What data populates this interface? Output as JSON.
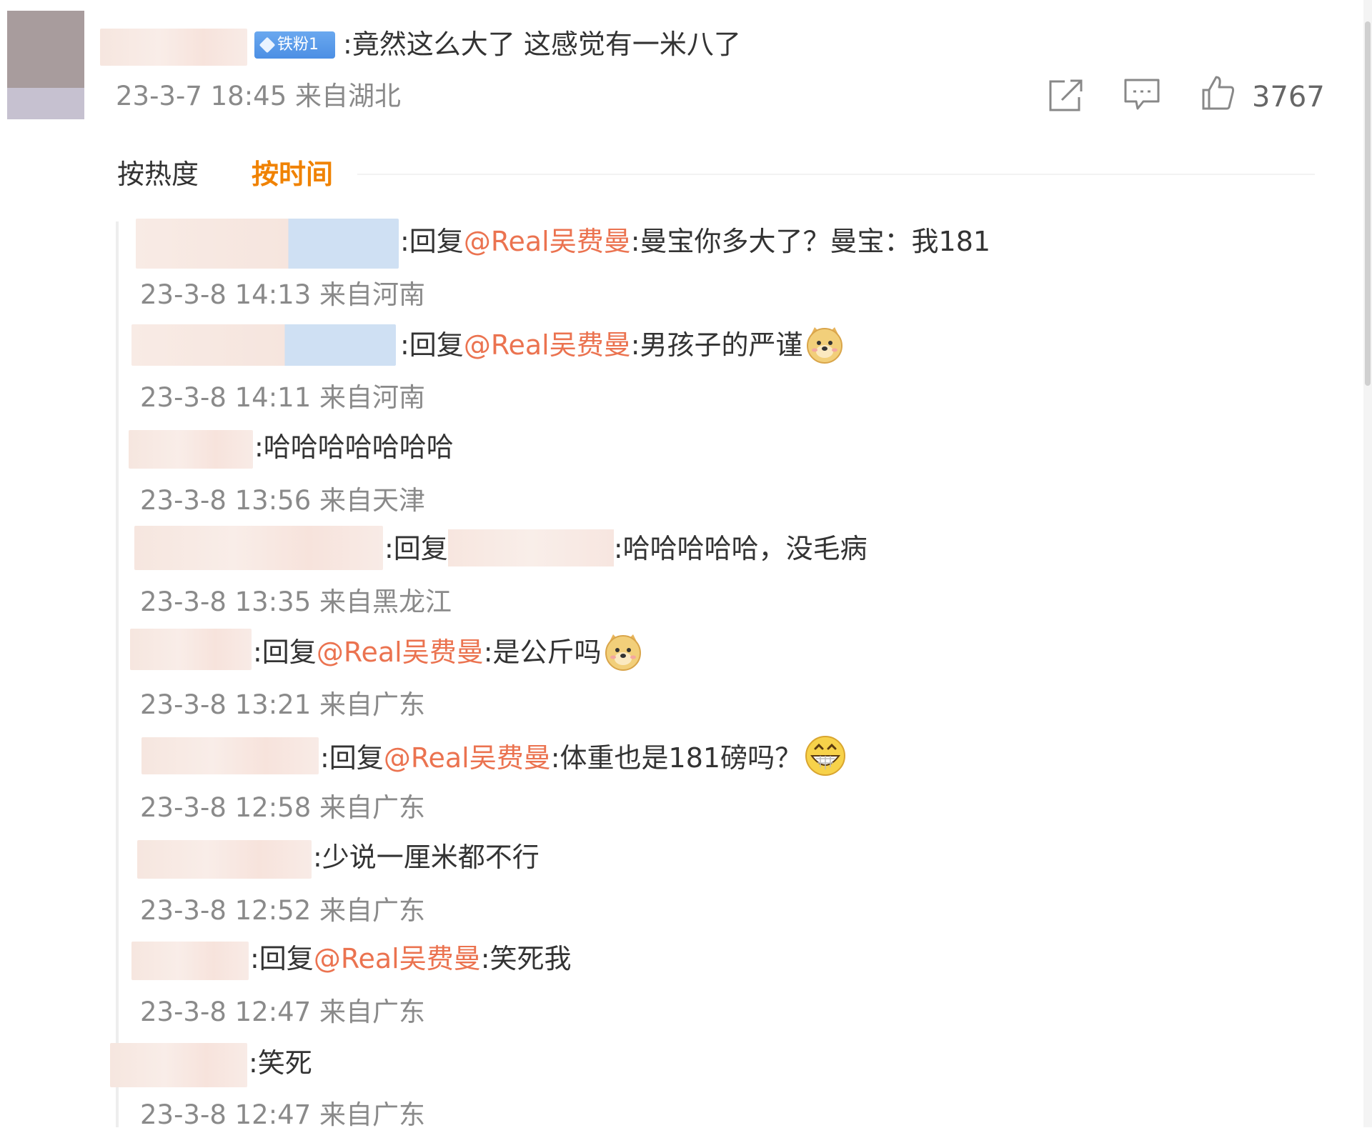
{
  "comment": {
    "badge_label": "铁粉1",
    "text": ":竟然这么大了 这感觉有一米八了",
    "meta": "23-3-7 18:45 来自湖北",
    "like_count": "3767"
  },
  "sort": {
    "hot_label": "按热度",
    "time_label": "按时间"
  },
  "replies": [
    {
      "prefix": ":回复",
      "mention": "@Real吴费曼",
      "body": ":曼宝你多大了？曼宝：我181",
      "meta": "23-3-8 14:13 来自河南"
    },
    {
      "prefix": ":回复",
      "mention": "@Real吴费曼",
      "body": ":男孩子的严谨",
      "emoji": "doge-emoji",
      "meta": "23-3-8 14:11 来自河南"
    },
    {
      "body": ":哈哈哈哈哈哈哈",
      "meta": "23-3-8 13:56 来自天津"
    },
    {
      "prefix": ":回复",
      "body2": ":哈哈哈哈哈，没毛病",
      "meta": "23-3-8 13:35 来自黑龙江"
    },
    {
      "prefix": ":回复",
      "mention": "@Real吴费曼",
      "body": ":是公斤吗",
      "emoji": "doge-emoji",
      "meta": "23-3-8 13:21 来自广东"
    },
    {
      "prefix": ":回复",
      "mention": "@Real吴费曼",
      "body": ":体重也是181磅吗？",
      "emoji": "grin-emoji",
      "meta": "23-3-8 12:58 来自广东"
    },
    {
      "body": ":少说一厘米都不行",
      "meta": "23-3-8 12:52 来自广东"
    },
    {
      "prefix": ":回复",
      "mention": "@Real吴费曼",
      "body": ":笑死我",
      "meta": "23-3-8 12:47 来自广东"
    },
    {
      "body": ":笑死",
      "meta": "23-3-8 12:47 来自广东"
    }
  ],
  "colors": {
    "accent": "#f08200",
    "mention": "#eb7350",
    "meta": "#8a8a8a",
    "badge": "#5a9ae8"
  }
}
